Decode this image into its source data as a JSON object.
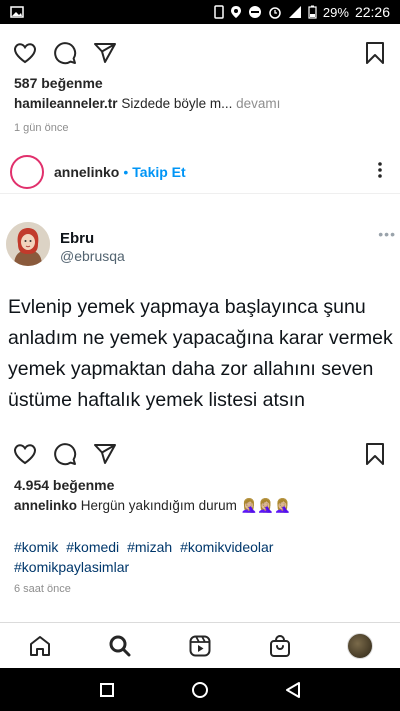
{
  "status_bar": {
    "battery": "29%",
    "time": "22:26",
    "icons": [
      "image-icon",
      "phone-icon",
      "location-icon",
      "dnd-icon",
      "alarm-icon",
      "signal-icon",
      "battery-icon"
    ]
  },
  "prev_post": {
    "likes": "587 beğenme",
    "caption_user": "hamileanneler.tr",
    "caption_text": "Sizdede böyle m...",
    "more_label": "devamı",
    "time": "1 gün önce"
  },
  "post": {
    "username": "annelinko",
    "separator": "•",
    "follow_label": "Takip Et",
    "tweet": {
      "name": "Ebru",
      "handle": "@ebrusqa",
      "menu": "•••",
      "text": "Evlenip yemek yapmaya başlayınca şunu anladım ne yemek yapacağına karar vermek yemek yapmaktan daha zor allahını seven üstüme haftalık yemek listesi atsın"
    },
    "likes": "4.954 beğenme",
    "caption_user": "annelinko",
    "caption_text": "Hergün yakındığım durum 🤦🏼‍♀️🤦🏼‍♀️🤦🏼‍♀️",
    "hashtags": [
      "#komik",
      "#komedi",
      "#mizah",
      "#komikvideolar",
      "#komikpaylasimlar"
    ],
    "time": "6 saat önce"
  },
  "bottom_nav": [
    "home-icon",
    "search-icon",
    "reels-icon",
    "shop-icon",
    "profile-avatar"
  ],
  "colors": {
    "accent": "#0095f6",
    "hashtag": "#00376b",
    "muted": "#8e8e8e",
    "story_ring": "#e1306c"
  }
}
